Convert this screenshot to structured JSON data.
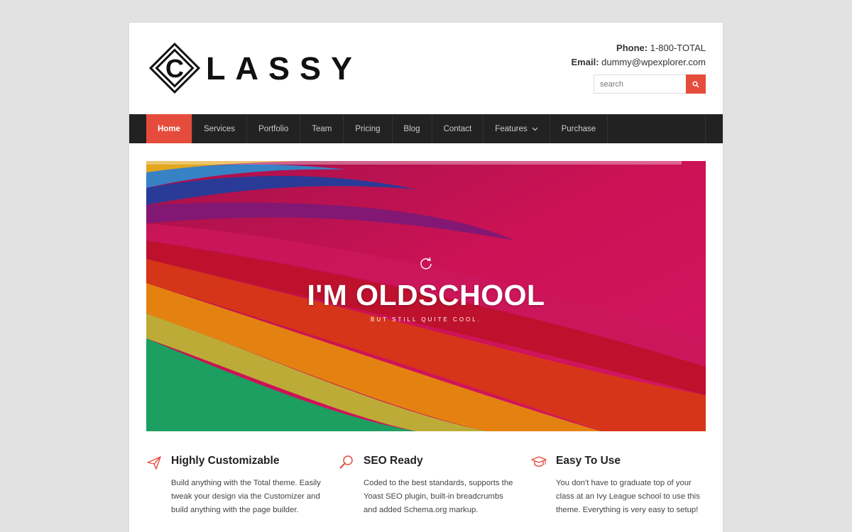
{
  "logo": {
    "text": "LASSY",
    "mark_letter": "C"
  },
  "contact": {
    "phone_label": "Phone:",
    "phone_value": " 1-800-TOTAL",
    "email_label": "Email:",
    "email_value": " dummy@wpexplorer.com"
  },
  "search": {
    "placeholder": "search",
    "icon": "search-icon"
  },
  "nav": {
    "items": [
      {
        "label": "Home",
        "active": true
      },
      {
        "label": "Services"
      },
      {
        "label": "Portfolio"
      },
      {
        "label": "Team"
      },
      {
        "label": "Pricing"
      },
      {
        "label": "Blog"
      },
      {
        "label": "Contact"
      },
      {
        "label": "Features",
        "has_dropdown": true
      },
      {
        "label": "Purchase"
      }
    ]
  },
  "hero": {
    "title": "I'M OLDSCHOOL",
    "subtitle": "BUT STILL QUITE COOL.",
    "icon": "refresh-icon"
  },
  "features": [
    {
      "icon": "paper-plane-icon",
      "title": "Highly Customizable",
      "text": "Build anything with the Total theme. Easily tweak your design via the Customizer and build anything with the page builder."
    },
    {
      "icon": "magnifier-icon",
      "title": "SEO Ready",
      "text": "Coded to the best standards, supports the Yoast SEO plugin, built-in breadcrumbs and added Schema.org markup."
    },
    {
      "icon": "graduation-cap-icon",
      "title": "Easy To Use",
      "text": "You don't have to graduate top of your class at an Ivy League school to use this theme. Everything is very easy to setup!"
    }
  ],
  "colors": {
    "accent": "#e64c3c",
    "nav_bg": "#222222",
    "page_bg": "#e2e2e2"
  }
}
